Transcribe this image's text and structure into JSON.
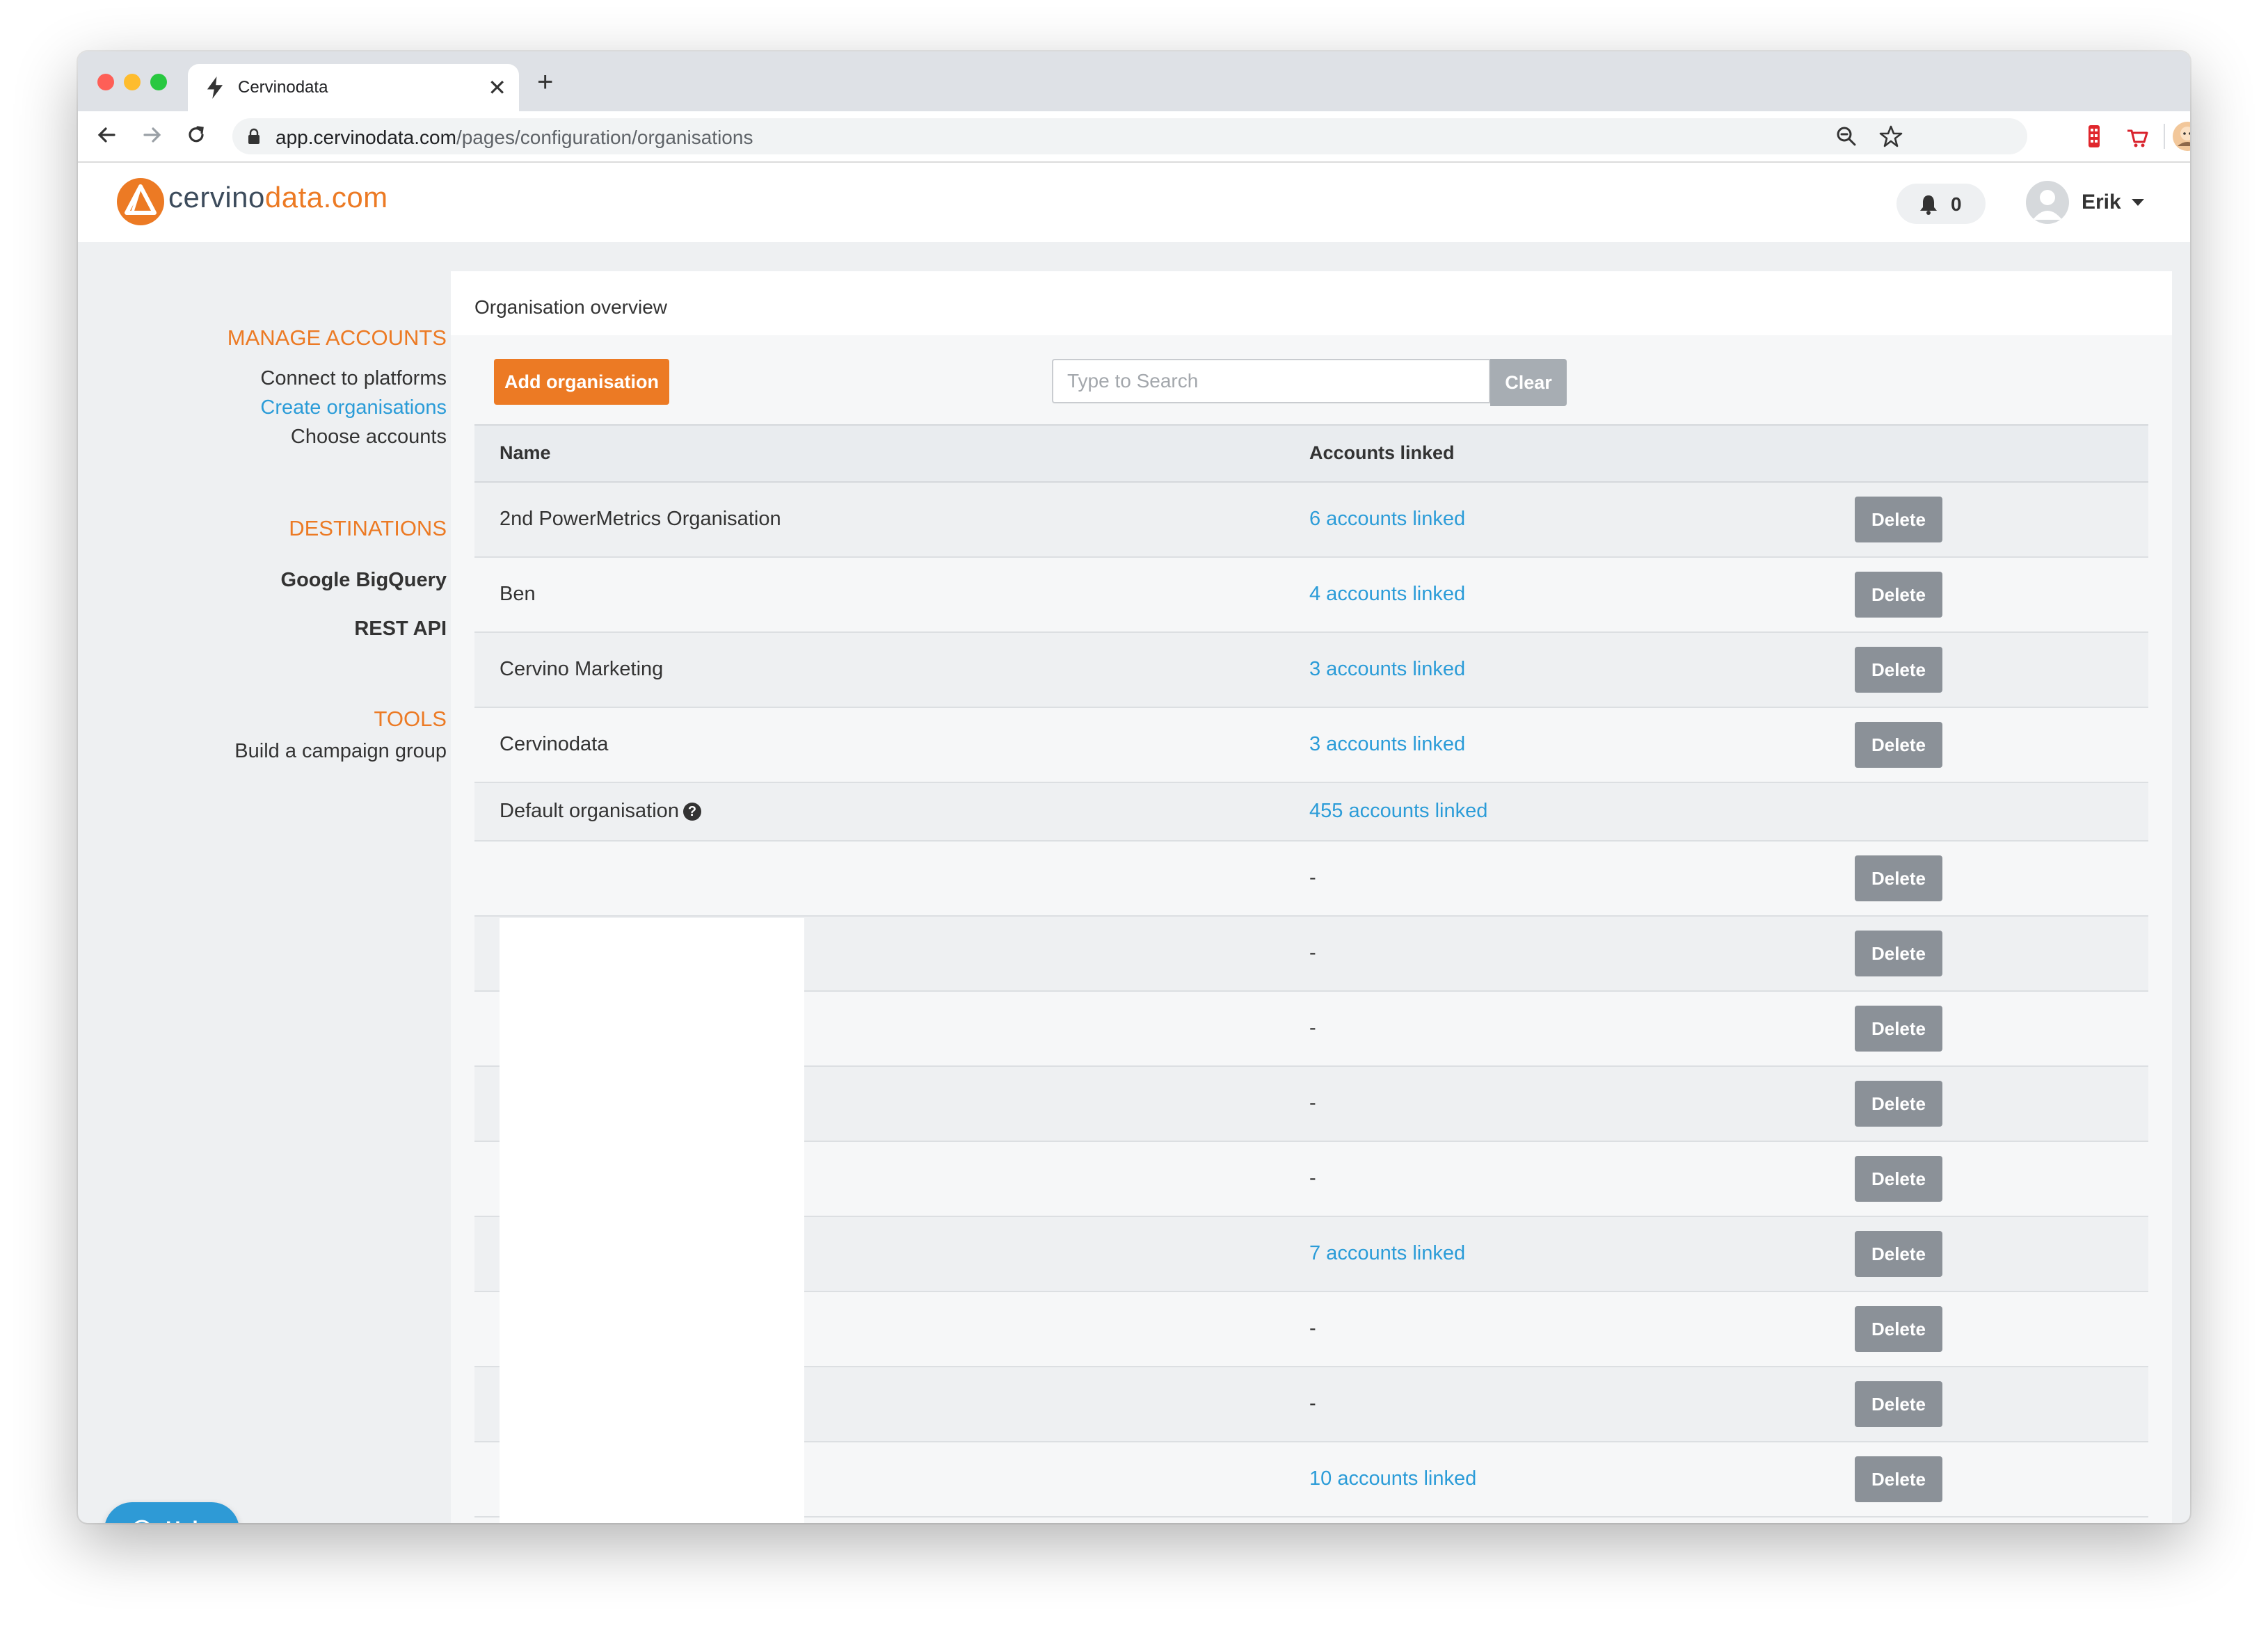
{
  "browser": {
    "tab_title": "Cervinodata",
    "url_host": "app.cervinodata.com",
    "url_path": "/pages/configuration/organisations",
    "new_tab_label": "+",
    "close_tab_label": "✕"
  },
  "app": {
    "logo_part1": "cervino",
    "logo_part2": "data.com",
    "notifications_count": "0",
    "user_name": "Erik"
  },
  "sidebar": {
    "manage_accounts_heading": "MANAGE ACCOUNTS",
    "connect_label": "Connect to platforms",
    "create_orgs_label": "Create organisations",
    "choose_accounts_label": "Choose accounts",
    "destinations_heading": "DESTINATIONS",
    "bigquery_label": "Google BigQuery",
    "rest_api_label": "REST API",
    "tools_heading": "TOOLS",
    "campaign_group_label": "Build a campaign group",
    "help_label": "Help"
  },
  "main": {
    "panel_title": "Organisation overview",
    "add_button": "Add organisation",
    "search_placeholder": "Type to Search",
    "clear_button": "Clear",
    "col_name": "Name",
    "col_linked": "Accounts linked",
    "delete_label": "Delete",
    "help_icon_glyph": "?",
    "rows": [
      {
        "name": "2nd PowerMetrics Organisation",
        "linked": "6 accounts linked"
      },
      {
        "name": "Ben",
        "linked": "4 accounts linked"
      },
      {
        "name": "Cervino Marketing",
        "linked": "3 accounts linked"
      },
      {
        "name": "Cervinodata",
        "linked": "3 accounts linked"
      },
      {
        "name": "Default organisation",
        "linked": "455 accounts linked"
      },
      {
        "name": "",
        "linked": "-"
      },
      {
        "name": "",
        "linked": "-"
      },
      {
        "name": "",
        "linked": "-"
      },
      {
        "name": "",
        "linked": "-"
      },
      {
        "name": "",
        "linked": "-"
      },
      {
        "name": "",
        "linked": "7 accounts linked"
      },
      {
        "name": "",
        "linked": "-"
      },
      {
        "name": "",
        "linked": "-"
      },
      {
        "name": "",
        "linked": "10 accounts linked"
      }
    ]
  },
  "colors": {
    "brand_orange": "#ec7a24",
    "link_blue": "#2b9cd8",
    "delete_gray": "#8b9198",
    "help_blue": "#2e9ad6"
  }
}
